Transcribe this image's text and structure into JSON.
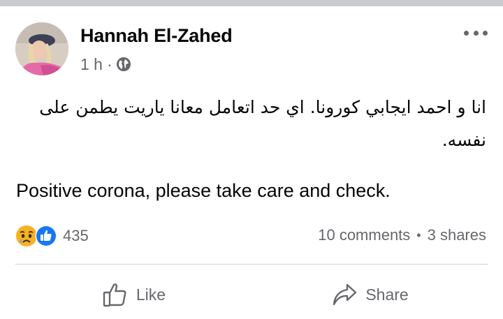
{
  "post": {
    "author": "Hannah El-Zahed",
    "time": "1 h",
    "meta_separator": "·",
    "audience_icon": "globe-icon",
    "more_icon": "more-options-icon",
    "text_arabic": "انا و احمد ايجابي كورونا. اي حد اتعامل معانا ياريت يطمن على نفسه.",
    "text_english": "Positive corona, please take care and check."
  },
  "engagement": {
    "reaction_icons": [
      "sad-reaction-icon",
      "like-reaction-icon"
    ],
    "reaction_count": "435",
    "comments": "10 comments",
    "separator": "•",
    "shares": "3 shares"
  },
  "actions": {
    "like_label": "Like",
    "share_label": "Share"
  },
  "colors": {
    "primary_text": "#050505",
    "secondary_text": "#65676b",
    "divider": "#ced0d4",
    "like_blue": "#1877f2",
    "sad_yellow": "#f7b125"
  }
}
